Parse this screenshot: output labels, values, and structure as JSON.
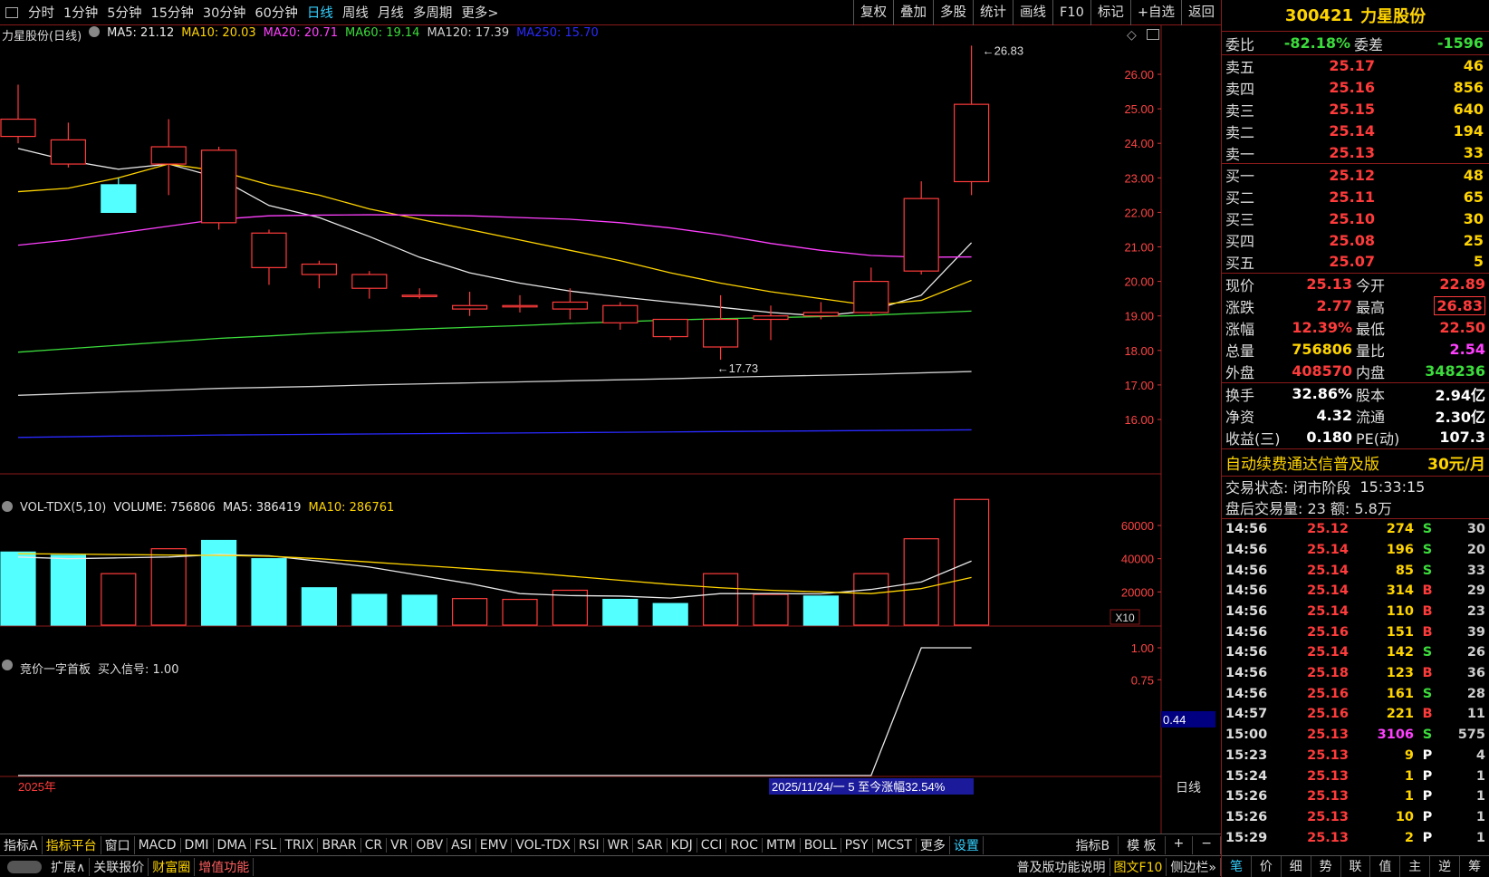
{
  "toolbar": {
    "periods": [
      "分时",
      "1分钟",
      "5分钟",
      "15分钟",
      "30分钟",
      "60分钟",
      "日线",
      "周线",
      "月线",
      "多周期",
      "更多>"
    ],
    "active_period": "日线",
    "right_tools": [
      "复权",
      "叠加",
      "多股",
      "统计",
      "画线",
      "F10",
      "标记",
      "+自选",
      "返回"
    ]
  },
  "kline_header": {
    "name": "力星股份(日线)",
    "ma5": "MA5: 21.12",
    "ma10": "MA10: 20.03",
    "ma20": "MA20: 20.71",
    "ma60": "MA60: 19.14",
    "ma120": "MA120: 17.39",
    "ma250": "MA250: 15.70"
  },
  "vol_header": {
    "name": "VOL-TDX(5,10)",
    "volume": "VOLUME: 756806",
    "ma5": "MA5: 386419",
    "ma10": "MA10: 286761"
  },
  "ind_header": {
    "name": "竞价一字首板",
    "signal": "买入信号: 1.00"
  },
  "annotations": {
    "high": "26.83",
    "low": "17.73",
    "year": "2025年",
    "range_label": "2025/11/24/一 5 至今涨幅32.54%",
    "period_tag": "日线",
    "x10": "X10",
    "ind_cursor": "0.44"
  },
  "chart_data": [
    {
      "type": "candlestick",
      "title": "力星股份(日线)",
      "ylim": [
        15.2,
        27.4
      ],
      "yticks": [
        16.0,
        17.0,
        18.0,
        19.0,
        20.0,
        21.0,
        22.0,
        23.0,
        24.0,
        25.0,
        26.0
      ],
      "candles": [
        {
          "o": 24.2,
          "c": 24.7,
          "h": 25.7,
          "l": 24.0
        },
        {
          "o": 23.4,
          "c": 24.1,
          "h": 24.6,
          "l": 23.3
        },
        {
          "o": 22.8,
          "c": 22.0,
          "h": 23.0,
          "l": 22.0
        },
        {
          "o": 23.4,
          "c": 23.9,
          "h": 24.7,
          "l": 22.5
        },
        {
          "o": 21.7,
          "c": 23.8,
          "h": 23.9,
          "l": 21.5
        },
        {
          "o": 20.4,
          "c": 21.4,
          "h": 21.5,
          "l": 19.9
        },
        {
          "o": 20.2,
          "c": 20.5,
          "h": 20.6,
          "l": 19.8
        },
        {
          "o": 19.8,
          "c": 20.2,
          "h": 20.3,
          "l": 19.5
        },
        {
          "o": 19.6,
          "c": 19.6,
          "h": 19.8,
          "l": 19.5
        },
        {
          "o": 19.2,
          "c": 19.3,
          "h": 19.7,
          "l": 19.0
        },
        {
          "o": 19.3,
          "c": 19.3,
          "h": 19.6,
          "l": 19.1
        },
        {
          "o": 19.2,
          "c": 19.4,
          "h": 19.8,
          "l": 18.9
        },
        {
          "o": 18.8,
          "c": 19.3,
          "h": 19.4,
          "l": 18.6
        },
        {
          "o": 18.4,
          "c": 18.9,
          "h": 18.9,
          "l": 18.3
        },
        {
          "o": 18.1,
          "c": 18.9,
          "h": 19.6,
          "l": 17.73
        },
        {
          "o": 18.9,
          "c": 19.0,
          "h": 19.3,
          "l": 18.3
        },
        {
          "o": 19.0,
          "c": 19.1,
          "h": 19.4,
          "l": 18.9
        },
        {
          "o": 19.1,
          "c": 20.0,
          "h": 20.4,
          "l": 19.0
        },
        {
          "o": 20.3,
          "c": 22.4,
          "h": 22.9,
          "l": 20.2
        },
        {
          "o": 22.89,
          "c": 25.13,
          "h": 26.83,
          "l": 22.5
        }
      ],
      "ma": {
        "MA5": [
          23.85,
          23.5,
          23.25,
          23.4,
          23.0,
          22.2,
          21.85,
          21.3,
          20.7,
          20.25,
          19.95,
          19.72,
          19.55,
          19.4,
          19.25,
          19.1,
          19.0,
          19.15,
          19.6,
          21.12
        ],
        "MA10": [
          22.6,
          22.7,
          23.0,
          23.4,
          23.2,
          22.8,
          22.5,
          22.1,
          21.8,
          21.5,
          21.2,
          20.9,
          20.6,
          20.25,
          19.95,
          19.7,
          19.5,
          19.3,
          19.45,
          20.03
        ],
        "MA20": [
          21.05,
          21.2,
          21.4,
          21.6,
          21.8,
          21.9,
          21.92,
          21.93,
          21.92,
          21.9,
          21.85,
          21.8,
          21.7,
          21.55,
          21.35,
          21.1,
          20.9,
          20.75,
          20.7,
          20.71
        ],
        "MA60": [
          17.95,
          18.05,
          18.15,
          18.25,
          18.35,
          18.42,
          18.5,
          18.56,
          18.62,
          18.67,
          18.72,
          18.78,
          18.83,
          18.88,
          18.92,
          18.95,
          18.98,
          19.02,
          19.08,
          19.14
        ],
        "MA120": [
          16.7,
          16.75,
          16.8,
          16.85,
          16.9,
          16.93,
          16.96,
          17.0,
          17.03,
          17.06,
          17.09,
          17.12,
          17.15,
          17.18,
          17.22,
          17.25,
          17.28,
          17.31,
          17.35,
          17.39
        ],
        "MA250": [
          15.48,
          15.5,
          15.52,
          15.53,
          15.55,
          15.56,
          15.57,
          15.58,
          15.59,
          15.6,
          15.61,
          15.62,
          15.63,
          15.64,
          15.65,
          15.66,
          15.67,
          15.68,
          15.69,
          15.7
        ]
      },
      "ma_colors": {
        "MA5": "#e8e8e8",
        "MA10": "#ffd400",
        "MA20": "#ff40ff",
        "MA60": "#3cdc3c",
        "MA120": "#cfcfcf",
        "MA250": "#2a2aff"
      }
    },
    {
      "type": "bar",
      "title": "VOL-TDX(5,10)",
      "ylim": [
        0,
        78000
      ],
      "yticks": [
        20000,
        40000,
        60000
      ],
      "values": [
        44000,
        42000,
        31000,
        46000,
        51000,
        40000,
        22500,
        18500,
        18000,
        16000,
        15500,
        21000,
        15500,
        13000,
        31000,
        18500,
        17500,
        31000,
        52000,
        75680
      ],
      "up": [
        false,
        false,
        true,
        true,
        false,
        false,
        false,
        false,
        false,
        true,
        true,
        true,
        false,
        false,
        true,
        true,
        false,
        true,
        true,
        true
      ],
      "ma5": [
        41000,
        40000,
        40500,
        41000,
        42500,
        41800,
        38500,
        35000,
        30000,
        25000,
        19000,
        17800,
        17500,
        16300,
        19000,
        19000,
        18800,
        21500,
        26000,
        38600
      ],
      "ma10": [
        43000,
        42800,
        42500,
        42200,
        42000,
        41500,
        40000,
        38000,
        36000,
        34000,
        32000,
        29500,
        27000,
        24500,
        22500,
        21000,
        20000,
        19000,
        22000,
        28700
      ]
    },
    {
      "type": "line",
      "title": "竞价一字首板",
      "ylim": [
        0,
        1.1
      ],
      "yticks": [
        0.75,
        1.0
      ],
      "values": [
        0,
        0,
        0,
        0,
        0,
        0,
        0,
        0,
        0,
        0,
        0,
        0,
        0,
        0,
        0,
        0,
        0,
        0,
        1,
        1
      ]
    }
  ],
  "quote": {
    "code": "300421",
    "name": "力星股份",
    "weibi": {
      "label": "委比",
      "value": "-82.18%",
      "label2": "委差",
      "value2": "-1596"
    },
    "sells": [
      {
        "label": "卖五",
        "price": "25.17",
        "vol": "46"
      },
      {
        "label": "卖四",
        "price": "25.16",
        "vol": "856"
      },
      {
        "label": "卖三",
        "price": "25.15",
        "vol": "640"
      },
      {
        "label": "卖二",
        "price": "25.14",
        "vol": "194"
      },
      {
        "label": "卖一",
        "price": "25.13",
        "vol": "33"
      }
    ],
    "buys": [
      {
        "label": "买一",
        "price": "25.12",
        "vol": "48"
      },
      {
        "label": "买二",
        "price": "25.11",
        "vol": "65"
      },
      {
        "label": "买三",
        "price": "25.10",
        "vol": "30"
      },
      {
        "label": "买四",
        "price": "25.08",
        "vol": "25"
      },
      {
        "label": "买五",
        "price": "25.07",
        "vol": "5"
      }
    ],
    "stats1": [
      {
        "l": "现价",
        "v": "25.13",
        "l2": "今开",
        "v2": "22.89",
        "c": "red",
        "c2": "red"
      },
      {
        "l": "涨跌",
        "v": "2.77",
        "l2": "最高",
        "v2": "26.83",
        "c": "red",
        "c2": "red"
      },
      {
        "l": "涨幅",
        "v": "12.39%",
        "l2": "最低",
        "v2": "22.50",
        "c": "red",
        "c2": "red"
      },
      {
        "l": "总量",
        "v": "756806",
        "l2": "量比",
        "v2": "2.54",
        "c": "yellow",
        "c2": "mag"
      },
      {
        "l": "外盘",
        "v": "408570",
        "l2": "内盘",
        "v2": "348236",
        "c": "red",
        "c2": "green"
      }
    ],
    "stats2": [
      {
        "l": "换手",
        "v": "32.86%",
        "l2": "股本",
        "v2": "2.94亿"
      },
      {
        "l": "净资",
        "v": "4.32",
        "l2": "流通",
        "v2": "2.30亿"
      },
      {
        "l": "收益(三)",
        "v": "0.180",
        "l2": "PE(动)",
        "v2": "107.3"
      }
    ],
    "promo": "自动续费通达信普及版",
    "promo_price": "30元/月",
    "trade_status": "交易状态: 闭市阶段",
    "trade_time": "15:33:15",
    "after_hours": "盘后交易量: 23  额: 5.8万"
  },
  "ticks": [
    {
      "t": "14:56",
      "p": "25.12",
      "v": "274",
      "d": "S",
      "n": "30"
    },
    {
      "t": "14:56",
      "p": "25.14",
      "v": "196",
      "d": "S",
      "n": "20"
    },
    {
      "t": "14:56",
      "p": "25.14",
      "v": "85",
      "d": "S",
      "n": "33"
    },
    {
      "t": "14:56",
      "p": "25.14",
      "v": "314",
      "d": "B",
      "n": "29"
    },
    {
      "t": "14:56",
      "p": "25.14",
      "v": "110",
      "d": "B",
      "n": "23"
    },
    {
      "t": "14:56",
      "p": "25.16",
      "v": "151",
      "d": "B",
      "n": "39"
    },
    {
      "t": "14:56",
      "p": "25.14",
      "v": "142",
      "d": "S",
      "n": "26"
    },
    {
      "t": "14:56",
      "p": "25.18",
      "v": "123",
      "d": "B",
      "n": "36"
    },
    {
      "t": "14:56",
      "p": "25.16",
      "v": "161",
      "d": "S",
      "n": "28"
    },
    {
      "t": "14:57",
      "p": "25.16",
      "v": "221",
      "d": "B",
      "n": "11"
    },
    {
      "t": "15:00",
      "p": "25.13",
      "v": "3106",
      "d": "S",
      "n": "575"
    },
    {
      "t": "15:23",
      "p": "25.13",
      "v": "9",
      "d": "P",
      "n": "4"
    },
    {
      "t": "15:24",
      "p": "25.13",
      "v": "1",
      "d": "P",
      "n": "1"
    },
    {
      "t": "15:26",
      "p": "25.13",
      "v": "1",
      "d": "P",
      "n": "1"
    },
    {
      "t": "15:26",
      "p": "25.13",
      "v": "10",
      "d": "P",
      "n": "1"
    },
    {
      "t": "15:29",
      "p": "25.13",
      "v": "2",
      "d": "P",
      "n": "1"
    }
  ],
  "indicators": [
    "指标A",
    "指标平台",
    "窗口",
    "MACD",
    "DMI",
    "DMA",
    "FSL",
    "TRIX",
    "BRAR",
    "CR",
    "VR",
    "OBV",
    "ASI",
    "EMV",
    "VOL-TDX",
    "RSI",
    "WR",
    "SAR",
    "KDJ",
    "CCI",
    "ROC",
    "MTM",
    "BOLL",
    "PSY",
    "MCST",
    "更多",
    "设置"
  ],
  "indicators_right": [
    "指标B",
    "模 板",
    "+",
    "−"
  ],
  "bottom_left": [
    "扩展∧",
    "关联报价",
    "财富圈",
    "增值功能"
  ],
  "bottom_right": [
    "普及版功能说明",
    "图文F10",
    "侧边栏»"
  ],
  "right_tabs": [
    "笔",
    "价",
    "细",
    "势",
    "联",
    "值",
    "主",
    "逆",
    "筹"
  ]
}
